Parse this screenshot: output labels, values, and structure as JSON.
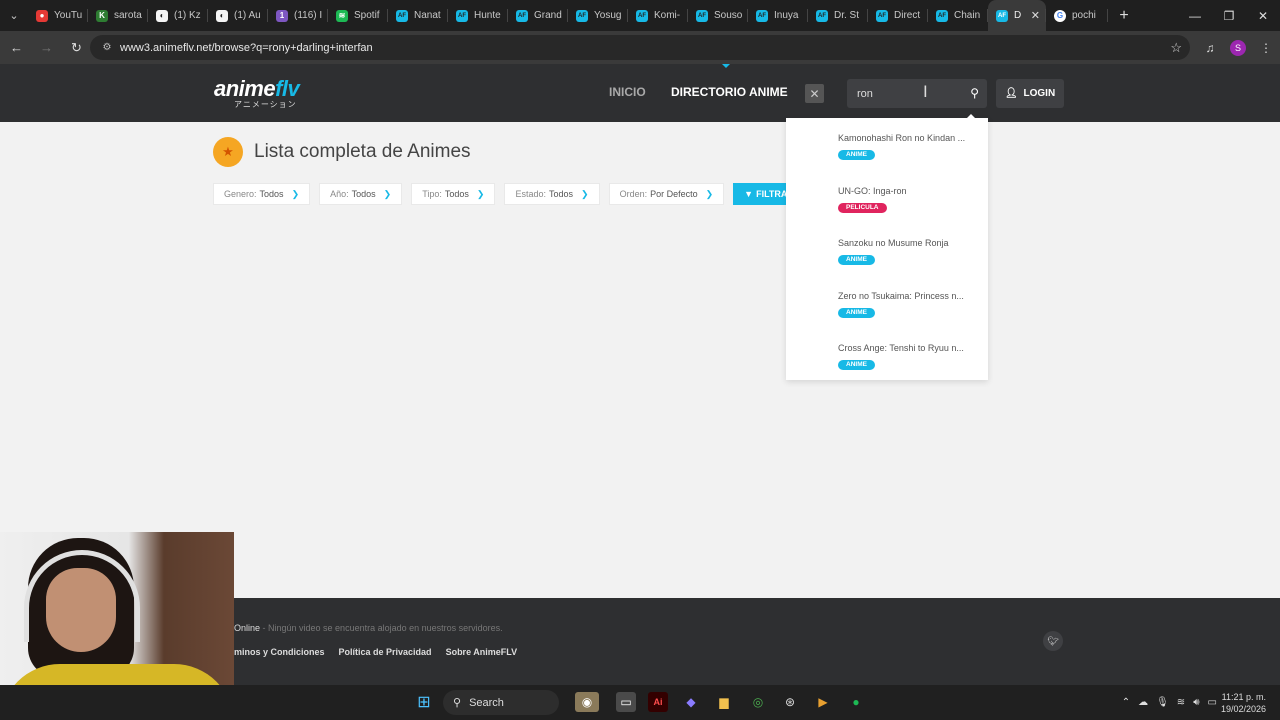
{
  "browser": {
    "tabs": [
      {
        "label": "YouTu",
        "fav_color": "#e53935",
        "fav": "●"
      },
      {
        "label": "sarota",
        "fav_color": "#2e7d32",
        "fav": "K"
      },
      {
        "label": "(1) Kz",
        "fav_color": "#f5f5f5",
        "fav": "◐"
      },
      {
        "label": "(1) Au",
        "fav_color": "#f5f5f5",
        "fav": "◐"
      },
      {
        "label": "(116) I",
        "fav_color": "#7e57c2",
        "fav": "1"
      },
      {
        "label": "Spotif",
        "fav_color": "#1db954",
        "fav": "≋"
      },
      {
        "label": "Nanat",
        "fav_color": "#17b9e6",
        "fav": "AF"
      },
      {
        "label": "Hunte",
        "fav_color": "#17b9e6",
        "fav": "AF"
      },
      {
        "label": "Grand",
        "fav_color": "#17b9e6",
        "fav": "AF"
      },
      {
        "label": "Yosug",
        "fav_color": "#17b9e6",
        "fav": "AF"
      },
      {
        "label": "Komi-",
        "fav_color": "#17b9e6",
        "fav": "AF"
      },
      {
        "label": "Souso",
        "fav_color": "#17b9e6",
        "fav": "AF"
      },
      {
        "label": "Inuya",
        "fav_color": "#17b9e6",
        "fav": "AF"
      },
      {
        "label": "Dr. St",
        "fav_color": "#17b9e6",
        "fav": "AF"
      },
      {
        "label": "Direct",
        "fav_color": "#17b9e6",
        "fav": "AF"
      },
      {
        "label": "Chain",
        "fav_color": "#17b9e6",
        "fav": "AF"
      }
    ],
    "active_tab": {
      "label": "D",
      "fav": "AF"
    },
    "last_tab": {
      "label": "pochi",
      "fav": "G"
    },
    "url": "www3.animeflv.net/browse?q=rony+darling+interfan",
    "profile_initial": "S"
  },
  "site": {
    "logo_text_a": "anime",
    "logo_text_b": "flv",
    "logo_sub": "アニメーション",
    "nav": {
      "inicio": "INICIO",
      "directorio": "DIRECTORIO ANIME"
    },
    "search_value": "ron",
    "login_label": "LOGIN",
    "accent_color": "#17b9e6"
  },
  "main": {
    "title": "Lista completa de Animes",
    "filters": [
      {
        "label": "Genero:",
        "value": "Todos"
      },
      {
        "label": "Año:",
        "value": "Todos"
      },
      {
        "label": "Tipo:",
        "value": "Todos"
      },
      {
        "label": "Estado:",
        "value": "Todos"
      },
      {
        "label": "Orden:",
        "value": "Por Defecto"
      }
    ],
    "filter_button": "FILTRAR"
  },
  "suggestions": [
    {
      "name": "Kamonohashi Ron no Kindan ...",
      "type": "ANIME",
      "type_color": "#17b9e6"
    },
    {
      "name": "UN-GO: Inga-ron",
      "type": "PELICULA",
      "type_color": "#e0245e"
    },
    {
      "name": "Sanzoku no Musume Ronja",
      "type": "ANIME",
      "type_color": "#17b9e6"
    },
    {
      "name": "Zero no Tsukaima: Princess n...",
      "type": "ANIME",
      "type_color": "#17b9e6"
    },
    {
      "name": "Cross Ange: Tenshi to Ryuu n...",
      "type": "ANIME",
      "type_color": "#17b9e6"
    }
  ],
  "footer": {
    "note_bold": "Online",
    "note_rest": " - Ningún video se encuentra alojado en nuestros servidores.",
    "links": [
      "minos y Condiciones",
      "Política de Privacidad",
      "Sobre AnimeFLV"
    ]
  },
  "taskbar": {
    "search_label": "Search",
    "time": "11:21 p. m.",
    "date": "19/02/2026"
  }
}
